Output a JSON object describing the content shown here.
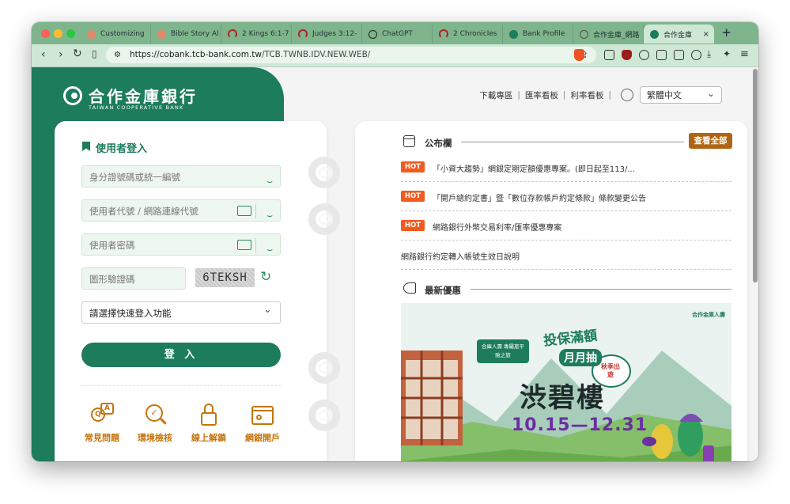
{
  "browser": {
    "tabs": [
      {
        "label": "Customizing",
        "icon": "sun-favicon-icon",
        "color": "#e08a6a"
      },
      {
        "label": "Bible Story Al",
        "icon": "sun-favicon-icon",
        "color": "#e08a6a"
      },
      {
        "label": "2 Kings 6:1-7",
        "icon": "horseshoe-favicon-icon",
        "color": "#b22222"
      },
      {
        "label": "Judges 3:12-",
        "icon": "horseshoe-favicon-icon",
        "color": "#b22222"
      },
      {
        "label": "ChatGPT",
        "icon": "chatgpt-favicon-icon",
        "color": "#222222"
      },
      {
        "label": "2 Chronicles",
        "icon": "horseshoe-favicon-icon",
        "color": "#b22222"
      },
      {
        "label": "Bank Profile",
        "icon": "bank-favicon-icon",
        "color": "#1d7c5b"
      },
      {
        "label": "合作金庫_網路",
        "icon": "globe-favicon-icon",
        "color": "#555555"
      },
      {
        "label": "合作金庫",
        "icon": "bank-favicon-icon",
        "color": "#1d7c5b",
        "active": true
      }
    ],
    "new_tab": "+",
    "tab_close": "×",
    "url_host": "https://cobank.tcb-bank.com.tw",
    "url_path": "/TCB.TWNB.IDV.NEW.WEB/"
  },
  "header": {
    "links": [
      "下載專區",
      "匯率看板",
      "利率看板"
    ],
    "separator": "|",
    "language": "繁體中文"
  },
  "logo": {
    "name_zh": "合作金庫銀行",
    "name_en": "TAIWAN COOPERATIVE BANK"
  },
  "login": {
    "title": "使用者登入",
    "id_placeholder": "身分證號碼或統一編號",
    "user_placeholder": "使用者代號 / 網路連線代號",
    "password_placeholder": "使用者密碼",
    "captcha_placeholder": "圖形驗證碼",
    "captcha_text": "6TEKSH",
    "quick_login": "請選擇快速登入功能",
    "submit": "登 入",
    "quick_links": [
      "常見問題",
      "環境檢核",
      "線上解鎖",
      "網銀開戶"
    ]
  },
  "bulletin": {
    "title": "公布欄",
    "view_all": "查看全部",
    "hot_label": "HOT",
    "items": [
      {
        "hot": true,
        "text": "「小資大趨勢」網銀定期定額優惠專案。(即日起至113/..."
      },
      {
        "hot": true,
        "text": "「開戶總約定書」暨「數位存款帳戶約定條款」條款變更公告"
      },
      {
        "hot": true,
        "text": "網路銀行外幣交易利率/匯率優惠專案"
      },
      {
        "hot": false,
        "text": "網路銀行約定轉入帳號生效日說明"
      }
    ]
  },
  "promo": {
    "title": "最新優惠",
    "banner_badge": "合庫人壽 專屬旅平險之旅",
    "banner_headline": "投保滿額",
    "banner_sub": "月月抽",
    "banner_title": "渋碧樓",
    "banner_dates": "10.15—12.31",
    "banner_tag": "秋季出遊",
    "banner_brand": "合作金庫人壽"
  },
  "colors": {
    "brand_green": "#1d7c5b",
    "accent_orange": "#b06513",
    "hot_red": "#f25a1f",
    "tab_bar": "#7fb58c"
  }
}
